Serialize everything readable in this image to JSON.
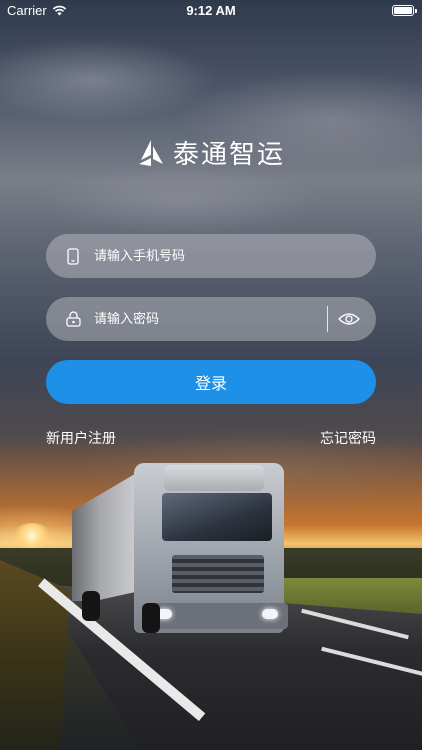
{
  "status_bar": {
    "carrier": "Carrier",
    "time": "9:12 AM"
  },
  "app": {
    "name": "泰通智运"
  },
  "login_form": {
    "phone_placeholder": "请输入手机号码",
    "password_placeholder": "请输入密码",
    "login_label": "登录",
    "register_label": "新用户注册",
    "forgot_label": "忘记密码"
  },
  "icons": {
    "signal": "wifi-icon",
    "battery": "battery-icon",
    "logo": "logo-mark-icon",
    "phone": "phone-icon",
    "lock": "lock-icon",
    "eye": "eye-icon"
  },
  "colors": {
    "primary": "#1e90e8"
  }
}
